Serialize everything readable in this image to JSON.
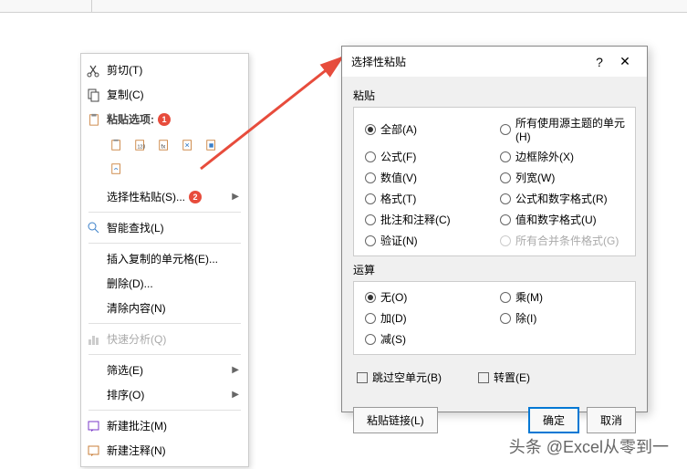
{
  "menu": {
    "cut": "剪切(T)",
    "copy": "复制(C)",
    "paste_options": "粘贴选项:",
    "paste_special": "选择性粘贴(S)...",
    "smart_lookup": "智能查找(L)",
    "insert_copied": "插入复制的单元格(E)...",
    "delete": "删除(D)...",
    "clear": "清除内容(N)",
    "quick_analysis": "快速分析(Q)",
    "filter": "筛选(E)",
    "sort": "排序(O)",
    "new_note": "新建批注(M)",
    "new_comment": "新建注释(N)"
  },
  "badges": {
    "b1": "1",
    "b2": "2"
  },
  "dialog": {
    "title": "选择性粘贴",
    "help": "?",
    "close": "✕",
    "paste_label": "粘贴",
    "operation_label": "运算",
    "paste_options": {
      "all": "全部(A)",
      "formulas": "公式(F)",
      "values": "数值(V)",
      "formats": "格式(T)",
      "comments": "批注和注释(C)",
      "validation": "验证(N)",
      "all_theme": "所有使用源主题的单元(H)",
      "all_except_borders": "边框除外(X)",
      "column_widths": "列宽(W)",
      "formulas_numfmt": "公式和数字格式(R)",
      "values_numfmt": "值和数字格式(U)",
      "all_merge": "所有合并条件格式(G)"
    },
    "operations": {
      "none": "无(O)",
      "add": "加(D)",
      "subtract": "减(S)",
      "multiply": "乘(M)",
      "divide": "除(I)"
    },
    "skip_blanks": "跳过空单元(B)",
    "transpose": "转置(E)",
    "paste_link": "粘贴链接(L)",
    "ok": "确定",
    "cancel": "取消"
  },
  "watermark": "头条 @Excel从零到一"
}
